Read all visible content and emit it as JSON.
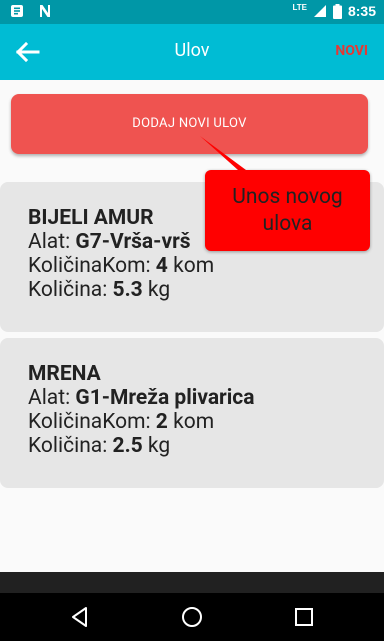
{
  "status": {
    "time": "8:35",
    "lte": "LTE"
  },
  "appbar": {
    "title": "Ulov",
    "action": "NOVI"
  },
  "add_button": {
    "label": "DODAJ NOVI ULOV"
  },
  "tooltip": {
    "text": "Unos novog ulova"
  },
  "catches": [
    {
      "name": "BIJELI AMUR",
      "alat_label": "Alat: ",
      "alat_value": "G7-Vrša-vrš",
      "kom_label": "KoličinaKom: ",
      "kom_value": "4",
      "kom_unit": " kom",
      "kol_label": "Količina: ",
      "kol_value": "5.3",
      "kol_unit": " kg"
    },
    {
      "name": "MRENA",
      "alat_label": "Alat: ",
      "alat_value": "G1-Mreža plivarica",
      "kom_label": "KoličinaKom: ",
      "kom_value": "2",
      "kom_unit": " kom",
      "kol_label": "Količina: ",
      "kol_value": "2.5",
      "kol_unit": " kg"
    }
  ],
  "colors": {
    "status_bar": "#0097a7",
    "app_bar": "#00bcd4",
    "accent_red": "#ef5350",
    "tooltip_red": "#ff0000",
    "card_bg": "#e6e6e6"
  }
}
